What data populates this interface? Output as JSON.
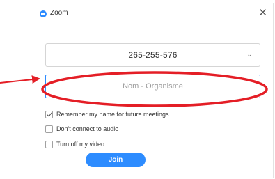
{
  "window": {
    "title": "Zoom",
    "close_label": "✕",
    "accent_color": "#2D8CFF"
  },
  "meeting_id": {
    "value": "265-255-576",
    "chevron": "⌄"
  },
  "name_field": {
    "placeholder": "Nom - Organisme"
  },
  "options": [
    {
      "label": "Remember my name for future meetings",
      "checked": true
    },
    {
      "label": "Don't connect to audio",
      "checked": false
    },
    {
      "label": "Turn off my video",
      "checked": false
    }
  ],
  "join_button": {
    "label": "Join"
  },
  "annotation": {
    "type": "arrow-and-ellipse",
    "color": "#E41E26"
  }
}
